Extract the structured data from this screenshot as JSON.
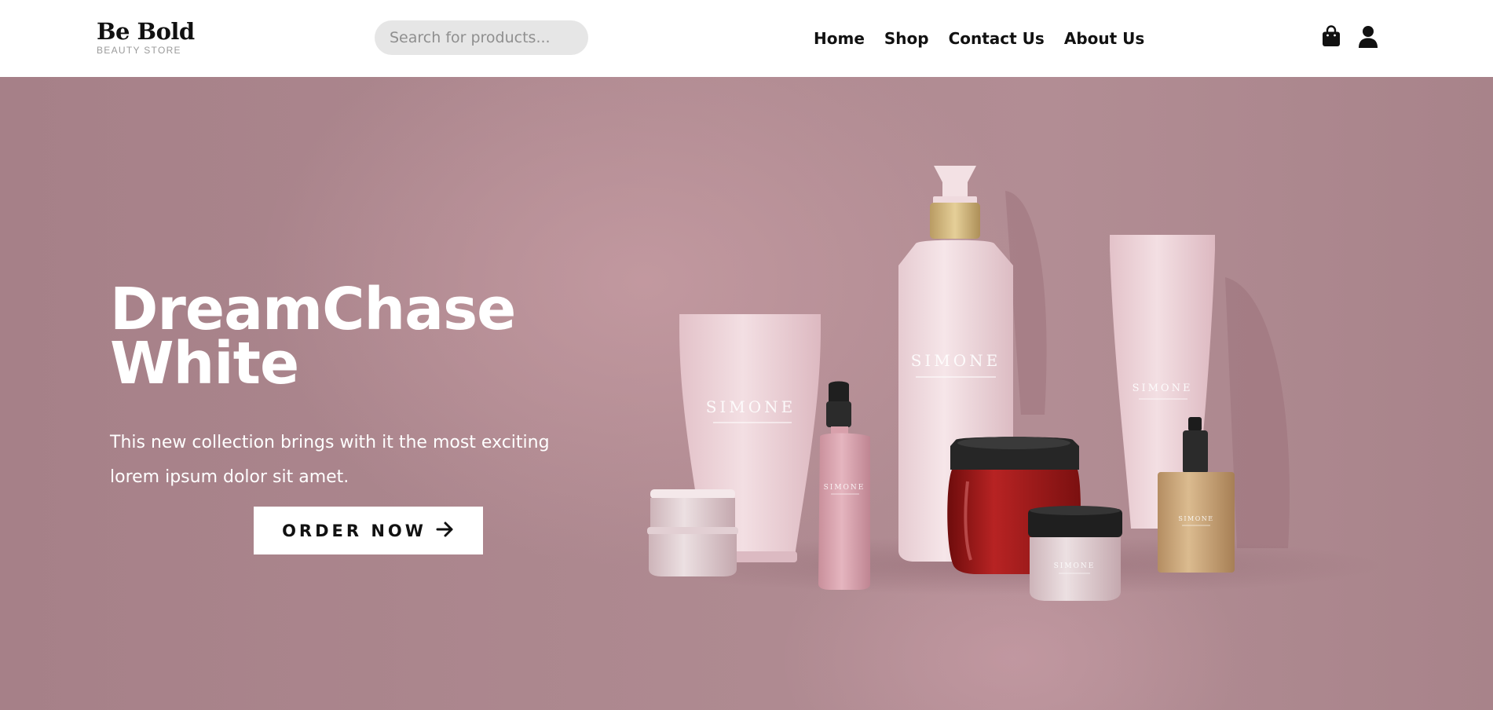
{
  "header": {
    "logo": {
      "title": "Be Bold",
      "subtitle": "BEAUTY STORE"
    },
    "search": {
      "placeholder": "Search for products..."
    },
    "nav": [
      {
        "label": "Home"
      },
      {
        "label": "Shop"
      },
      {
        "label": "Contact Us"
      },
      {
        "label": "About Us"
      }
    ],
    "icons": {
      "cart": "shopping-bag-icon",
      "account": "user-icon"
    }
  },
  "hero": {
    "title_line1": "DreamChase",
    "title_line2": "White",
    "description": "This new collection brings with it the most exciting lorem ipsum dolor sit amet.",
    "cta": {
      "label": "ORDER NOW",
      "icon": "arrow-right-icon"
    },
    "product_brand": "SIMONE",
    "colors": {
      "background": "#ad8890",
      "text": "#ffffff",
      "button_bg": "#ffffff",
      "button_text": "#111111",
      "tube_pink": "#ecd1d7",
      "jar_red": "#9e1b1b",
      "dropper_gold": "#caa67a"
    }
  }
}
